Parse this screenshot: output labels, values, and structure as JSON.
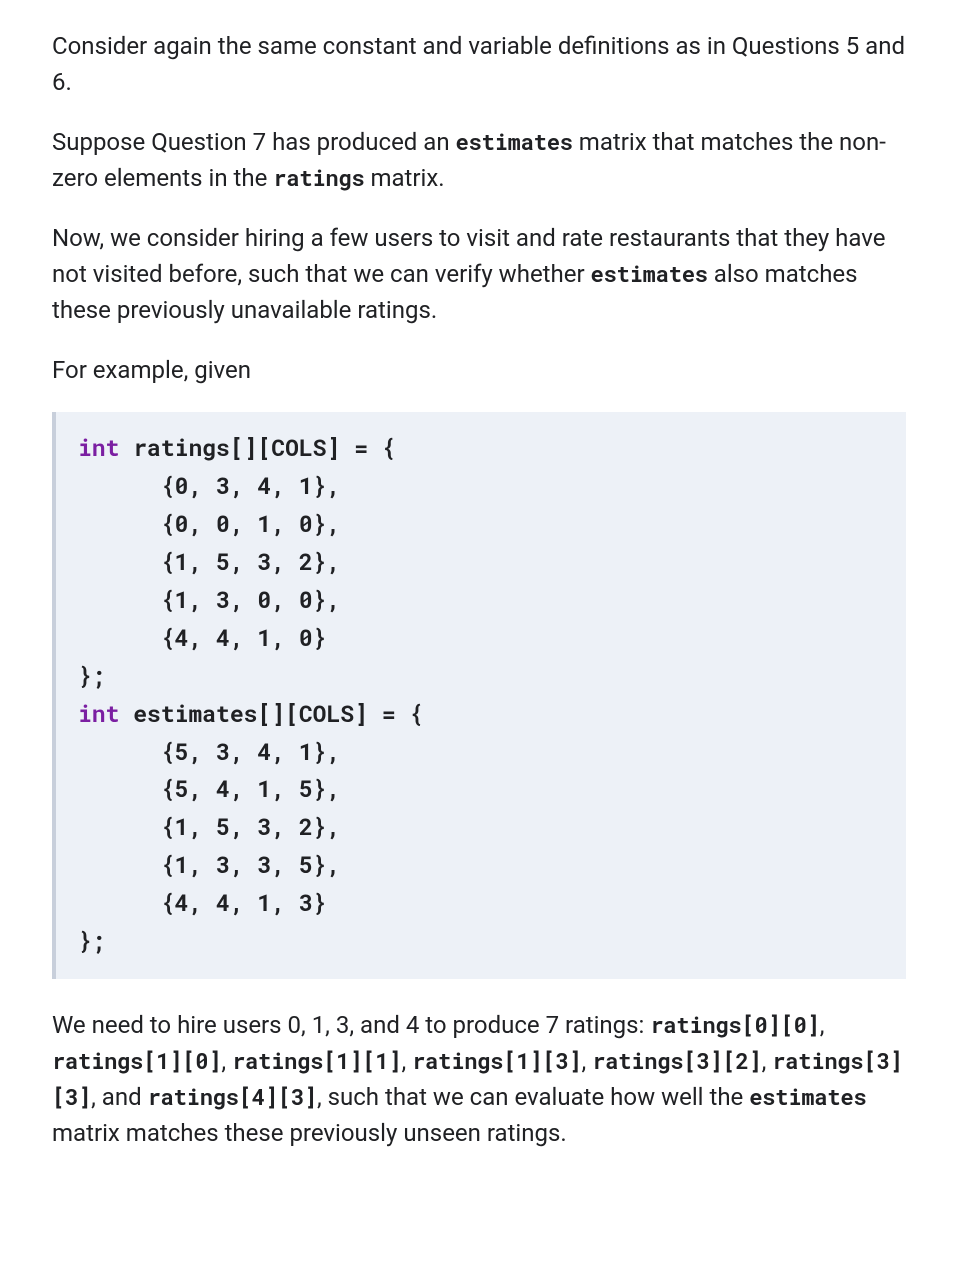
{
  "para1": {
    "full": "Consider again the same constant and variable definitions as in Questions 5 and 6."
  },
  "para2": {
    "p1": "Suppose Question 7 has produced an ",
    "c1": "estimates",
    "p2": " matrix that matches the non-zero elements in the ",
    "c2": "ratings",
    "p3": " matrix."
  },
  "para3": {
    "p1": "Now, we consider hiring a few users to visit and rate restaurants that they have not visited before, such that we can verify whether ",
    "c1": "estimates",
    "p2": " also matches these previously unavailable ratings."
  },
  "para4": {
    "full": "For example, given"
  },
  "code": {
    "kw_int1": "int",
    "sp1": " ",
    "id_ratings": "ratings",
    "arr_cols1": "[][COLS] = {",
    "row_r0": "      {0, 3, 4, 1},",
    "row_r1": "      {0, 0, 1, 0},",
    "row_r2": "      {1, 5, 3, 2},",
    "row_r3": "      {1, 3, 0, 0},",
    "row_r4": "      {4, 4, 1, 0}",
    "close1": "};",
    "kw_int2": "int",
    "sp2": " ",
    "id_estimates": "estimates",
    "arr_cols2": "[][COLS] = {",
    "row_e0": "      {5, 3, 4, 1},",
    "row_e1": "      {5, 4, 1, 5},",
    "row_e2": "      {1, 5, 3, 2},",
    "row_e3": "      {1, 3, 3, 5},",
    "row_e4": "      {4, 4, 1, 3}",
    "close2": "};"
  },
  "para5": {
    "p1": "We need to hire users 0, 1, 3, and 4 to produce 7 ratings: ",
    "c1": "ratings[0][0]",
    "s1": ", ",
    "c2": "ratings[1][0]",
    "s2": ", ",
    "c3": "ratings[1][1]",
    "s3": ", ",
    "c4": "ratings[1][3]",
    "s4": ", ",
    "c5": "ratings[3][2]",
    "s5": ", ",
    "c6": "ratings[3][3]",
    "s6": ", and ",
    "c7": "ratings[4][3]",
    "p2": ", such that we can evaluate how well the ",
    "c8": "estimates",
    "p3": " matrix matches these previously unseen ratings."
  }
}
